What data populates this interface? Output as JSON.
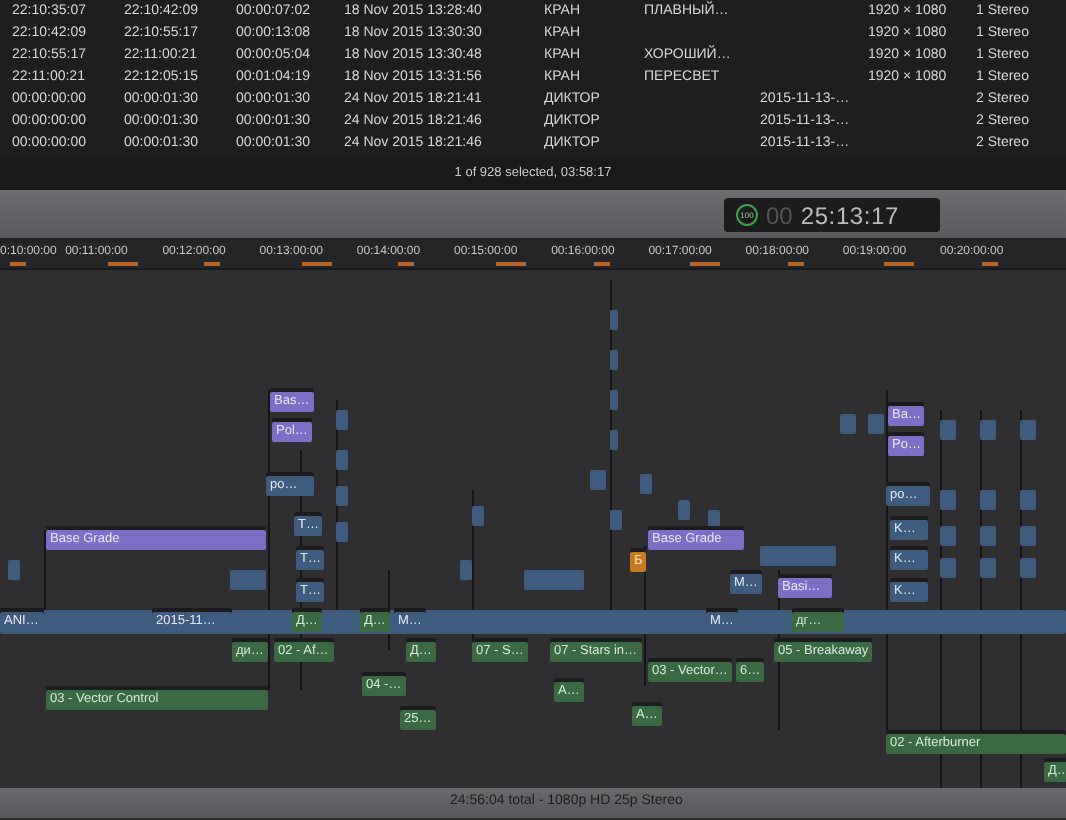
{
  "browser": {
    "rows": [
      {
        "column_1": "22:10:35:07",
        "column_2": "22:10:42:09",
        "column_3": "00:00:07:02",
        "column_4": "18 Nov 2015 13:28:40",
        "column_5": "КРАН",
        "column_6": "ПЛАВНЫЙ…",
        "column_8": "1920 × 1080",
        "column_9": "1 Stereo"
      },
      {
        "column_1": "22:10:42:09",
        "column_2": "22:10:55:17",
        "column_3": "00:00:13:08",
        "column_4": "18 Nov 2015 13:30:30",
        "column_5": "КРАН",
        "column_8": "1920 × 1080",
        "column_9": "1 Stereo"
      },
      {
        "column_1": "22:10:55:17",
        "column_2": "22:11:00:21",
        "column_3": "00:00:05:04",
        "column_4": "18 Nov 2015 13:30:48",
        "column_5": "КРАН",
        "column_6": "ХОРОШИЙ…",
        "column_8": "1920 × 1080",
        "column_9": "1 Stereo"
      },
      {
        "column_1": "22:11:00:21",
        "column_2": "22:12:05:15",
        "column_3": "00:01:04:19",
        "column_4": "18 Nov 2015 13:31:56",
        "column_5": "КРАН",
        "column_6": "ПЕРЕСВЕТ",
        "column_8": "1920 × 1080",
        "column_9": "1 Stereo"
      },
      {
        "column_1": "00:00:00:00",
        "column_2": "00:00:01:30",
        "column_3": "00:00:01:30",
        "column_4": "24 Nov 2015 18:21:41",
        "column_5": "ДИКТОР",
        "column_7": "2015-11-13-…",
        "column_9": "2 Stereo"
      },
      {
        "column_1": "00:00:00:00",
        "column_2": "00:00:01:30",
        "column_3": "00:00:01:30",
        "column_4": "24 Nov 2015 18:21:46",
        "column_5": "ДИКТОР",
        "column_7": "2015-11-13-…",
        "column_9": "2 Stereo"
      },
      {
        "column_1": "00:00:00:00",
        "column_2": "00:00:01:30",
        "column_3": "00:00:01:30",
        "column_4": "24 Nov 2015 18:21:46",
        "column_5": "ДИКТОР",
        "column_7": "2015-11-13-…",
        "column_9": "2 Stereo"
      }
    ],
    "status": "1 of 928 selected, 03:58:17"
  },
  "timecode": {
    "percent": "100",
    "hours_dim": "00",
    "time": "25:13:17"
  },
  "ruler": [
    "0:10:00:00",
    "00:11:00:00",
    "00:12:00:00",
    "00:13:00:00",
    "00:14:00:00",
    "00:15:00:00",
    "00:16:00:00",
    "00:17:00:00",
    "00:18:00:00",
    "00:19:00:00",
    "00:20:00:00"
  ],
  "clips": [
    {
      "label": "Base Grade",
      "kind": "title"
    },
    {
      "label": "Bas…",
      "kind": "title"
    },
    {
      "label": "Pol…",
      "kind": "title"
    },
    {
      "label": "po…",
      "kind": "video"
    },
    {
      "label": "T…",
      "kind": "video"
    },
    {
      "label": "T…",
      "kind": "video"
    },
    {
      "label": "T…",
      "kind": "video"
    },
    {
      "label": "ANI…",
      "kind": "video"
    },
    {
      "label": "2015-11…",
      "kind": "video"
    },
    {
      "label": "Д…",
      "kind": "audio"
    },
    {
      "label": "Д…",
      "kind": "audio"
    },
    {
      "label": "M…",
      "kind": "video"
    },
    {
      "label": "ди…",
      "kind": "audio"
    },
    {
      "label": "02 - Af…",
      "kind": "audio"
    },
    {
      "label": "Д…",
      "kind": "audio"
    },
    {
      "label": "04 -…",
      "kind": "audio"
    },
    {
      "label": "25…",
      "kind": "audio"
    },
    {
      "label": "03 - Vector Control",
      "kind": "audio"
    },
    {
      "label": "07 - S…",
      "kind": "audio"
    },
    {
      "label": "Base Grade",
      "kind": "title"
    },
    {
      "label": "Б",
      "kind": "generator"
    },
    {
      "label": "M…",
      "kind": "video"
    },
    {
      "label": "Basi…",
      "kind": "title"
    },
    {
      "label": "M…",
      "kind": "video"
    },
    {
      "label": "дг…",
      "kind": "audio"
    },
    {
      "label": "07 - Stars in…",
      "kind": "audio"
    },
    {
      "label": "03 - Vector…",
      "kind": "audio"
    },
    {
      "label": "6…",
      "kind": "audio"
    },
    {
      "label": "05 - Breakaway",
      "kind": "audio"
    },
    {
      "label": "А…",
      "kind": "audio"
    },
    {
      "label": "А…",
      "kind": "audio"
    },
    {
      "label": "02 - Afterburner",
      "kind": "audio"
    },
    {
      "label": "Д…",
      "kind": "audio"
    },
    {
      "label": "Ba…",
      "kind": "title"
    },
    {
      "label": "Po…",
      "kind": "title"
    },
    {
      "label": "po…",
      "kind": "video"
    },
    {
      "label": "K…",
      "kind": "video"
    },
    {
      "label": "K…",
      "kind": "video"
    },
    {
      "label": "K…",
      "kind": "video"
    }
  ],
  "footer": "24:56:04 total - 1080p HD 25p Stereo"
}
